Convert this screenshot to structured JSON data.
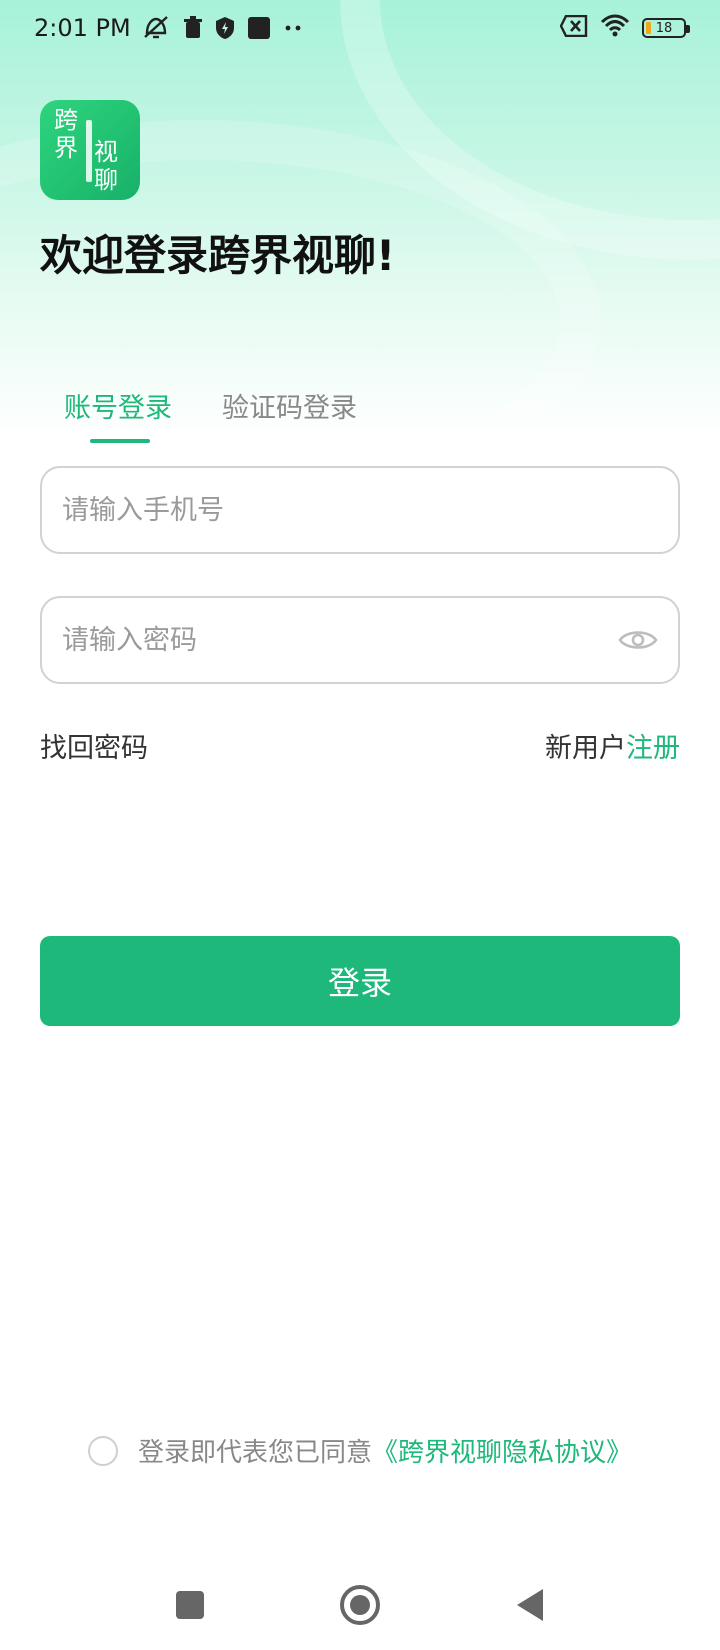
{
  "status_bar": {
    "time": "2:01 PM",
    "battery_level": "18",
    "icons": [
      "muted-icon",
      "trash-icon",
      "shield-icon",
      "square-icon",
      "more-dots-icon",
      "sim-error-icon",
      "wifi-icon",
      "battery-icon"
    ]
  },
  "app": {
    "logo_chars": [
      "跨",
      "界",
      "视",
      "聊"
    ],
    "welcome_title": "欢迎登录跨界视聊!"
  },
  "tabs": [
    {
      "label": "账号登录",
      "active": true
    },
    {
      "label": "验证码登录",
      "active": false
    }
  ],
  "form": {
    "phone_placeholder": "请输入手机号",
    "phone_value": "",
    "password_placeholder": "请输入密码",
    "password_value": ""
  },
  "links": {
    "forgot_password": "找回密码",
    "new_user": "新用户",
    "register": "注册"
  },
  "login_button": "登录",
  "agreement": {
    "checked": false,
    "text": "登录即代表您已同意",
    "privacy_link": "《跨界视聊隐私协议》"
  },
  "colors": {
    "accent": "#1fb87b",
    "header_gradient_top": "#a8f2da"
  }
}
